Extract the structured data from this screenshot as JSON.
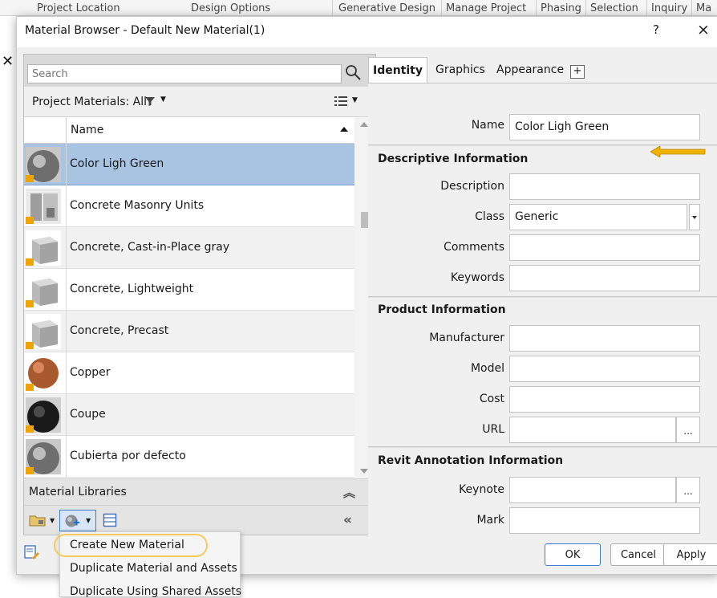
{
  "ribbon": {
    "tabs": [
      "Project Location",
      "Design Options",
      "Generative Design",
      "Manage Project",
      "Phasing",
      "Selection",
      "Inquiry",
      "Ma"
    ]
  },
  "dialog": {
    "title": "Material Browser - Default New Material(1)",
    "help": "?",
    "close": "×"
  },
  "left": {
    "search_placeholder": "Search",
    "project_materials_label": "Project Materials: All",
    "column_name": "Name",
    "materials": [
      {
        "name": "Color Ligh Green",
        "thumb": "sphere-gray",
        "selected": true
      },
      {
        "name": "Concrete Masonry Units",
        "thumb": "block-gray",
        "selected": false
      },
      {
        "name": "Concrete, Cast-in-Place gray",
        "thumb": "cube-gray",
        "selected": false
      },
      {
        "name": "Concrete, Lightweight",
        "thumb": "cube-gray",
        "selected": false
      },
      {
        "name": "Concrete, Precast",
        "thumb": "cube-gray",
        "selected": false
      },
      {
        "name": "Copper",
        "thumb": "sphere-copper",
        "selected": false
      },
      {
        "name": "Coupe",
        "thumb": "sphere-black",
        "selected": false
      },
      {
        "name": "Cubierta por defecto",
        "thumb": "sphere-gray",
        "selected": false
      }
    ],
    "material_libraries_label": "Material Libraries"
  },
  "right": {
    "tabs": {
      "identity": "Identity",
      "graphics": "Graphics",
      "appearance": "Appearance",
      "plus": "+"
    },
    "name_label": "Name",
    "name_value": "Color Ligh Green",
    "descriptive_title": "Descriptive Information",
    "description_label": "Description",
    "description_value": "",
    "class_label": "Class",
    "class_value": "Generic",
    "comments_label": "Comments",
    "comments_value": "",
    "keywords_label": "Keywords",
    "keywords_value": "",
    "product_title": "Product Information",
    "manufacturer_label": "Manufacturer",
    "manufacturer_value": "",
    "model_label": "Model",
    "model_value": "",
    "cost_label": "Cost",
    "cost_value": "",
    "url_label": "URL",
    "url_value": "",
    "ellipsis": "...",
    "annotation_title": "Revit Annotation Information",
    "keynote_label": "Keynote",
    "keynote_value": "",
    "mark_label": "Mark",
    "mark_value": ""
  },
  "buttons": {
    "ok": "OK",
    "cancel": "Cancel",
    "apply": "Apply"
  },
  "popup": {
    "items": [
      "Create New Material",
      "Duplicate Material and Assets",
      "Duplicate Using Shared Assets"
    ]
  },
  "colors": {
    "selection": "#a9c4e3",
    "highlight_arrow": "#f0b400",
    "oval": "#f5c95b",
    "accent": "#3f7ccc"
  }
}
